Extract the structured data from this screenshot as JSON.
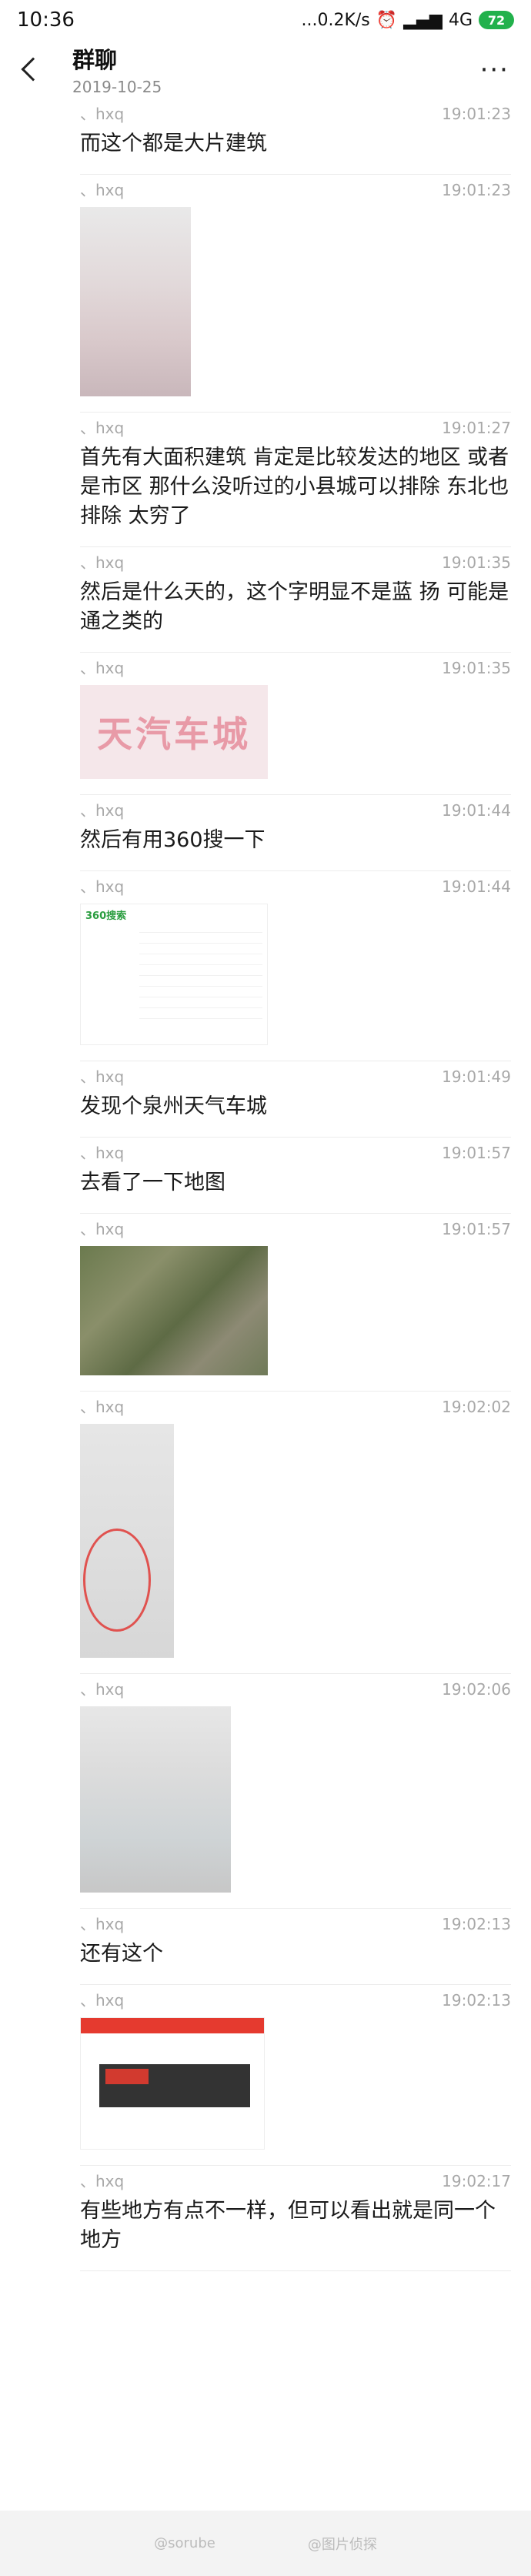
{
  "status": {
    "time": "10:36",
    "speed": "...0.2K/s",
    "network": "4G",
    "battery": "72"
  },
  "nav": {
    "title": "群聊",
    "date": "2019-10-25"
  },
  "messages": [
    {
      "sender": "、hxq",
      "time": "19:01:23",
      "text": "而这个都是大片建筑"
    },
    {
      "sender": "、hxq",
      "time": "19:01:23",
      "image": "blurred-photo"
    },
    {
      "sender": "、hxq",
      "time": "19:01:27",
      "text": "首先有大面积建筑 肯定是比较发达的地区 或者是市区 那什么没听过的小县城可以排除 东北也排除 太穷了"
    },
    {
      "sender": "、hxq",
      "time": "19:01:35",
      "text": "然后是什么天的，这个字明显不是蓝 扬 可能是通之类的"
    },
    {
      "sender": "、hxq",
      "time": "19:01:35",
      "image": "sign-banner",
      "image_text": "天汽车城"
    },
    {
      "sender": "、hxq",
      "time": "19:01:44",
      "text": "然后有用360搜一下"
    },
    {
      "sender": "、hxq",
      "time": "19:01:44",
      "image": "search-screenshot",
      "image_text": "360搜索"
    },
    {
      "sender": "、hxq",
      "time": "19:01:49",
      "text": "发现个泉州天气车城"
    },
    {
      "sender": "、hxq",
      "time": "19:01:57",
      "text": "去看了一下地图"
    },
    {
      "sender": "、hxq",
      "time": "19:01:57",
      "image": "satellite-map"
    },
    {
      "sender": "、hxq",
      "time": "19:02:02",
      "image": "circled-photo"
    },
    {
      "sender": "、hxq",
      "time": "19:02:06",
      "image": "building-photo"
    },
    {
      "sender": "、hxq",
      "time": "19:02:13",
      "text": "还有这个"
    },
    {
      "sender": "、hxq",
      "time": "19:02:13",
      "image": "car-city-screenshot"
    },
    {
      "sender": "、hxq",
      "time": "19:02:17",
      "text": "有些地方有点不一样，但可以看出就是同一个地方"
    }
  ],
  "footer": {
    "left": "@sorube",
    "right": "@图片侦探"
  }
}
